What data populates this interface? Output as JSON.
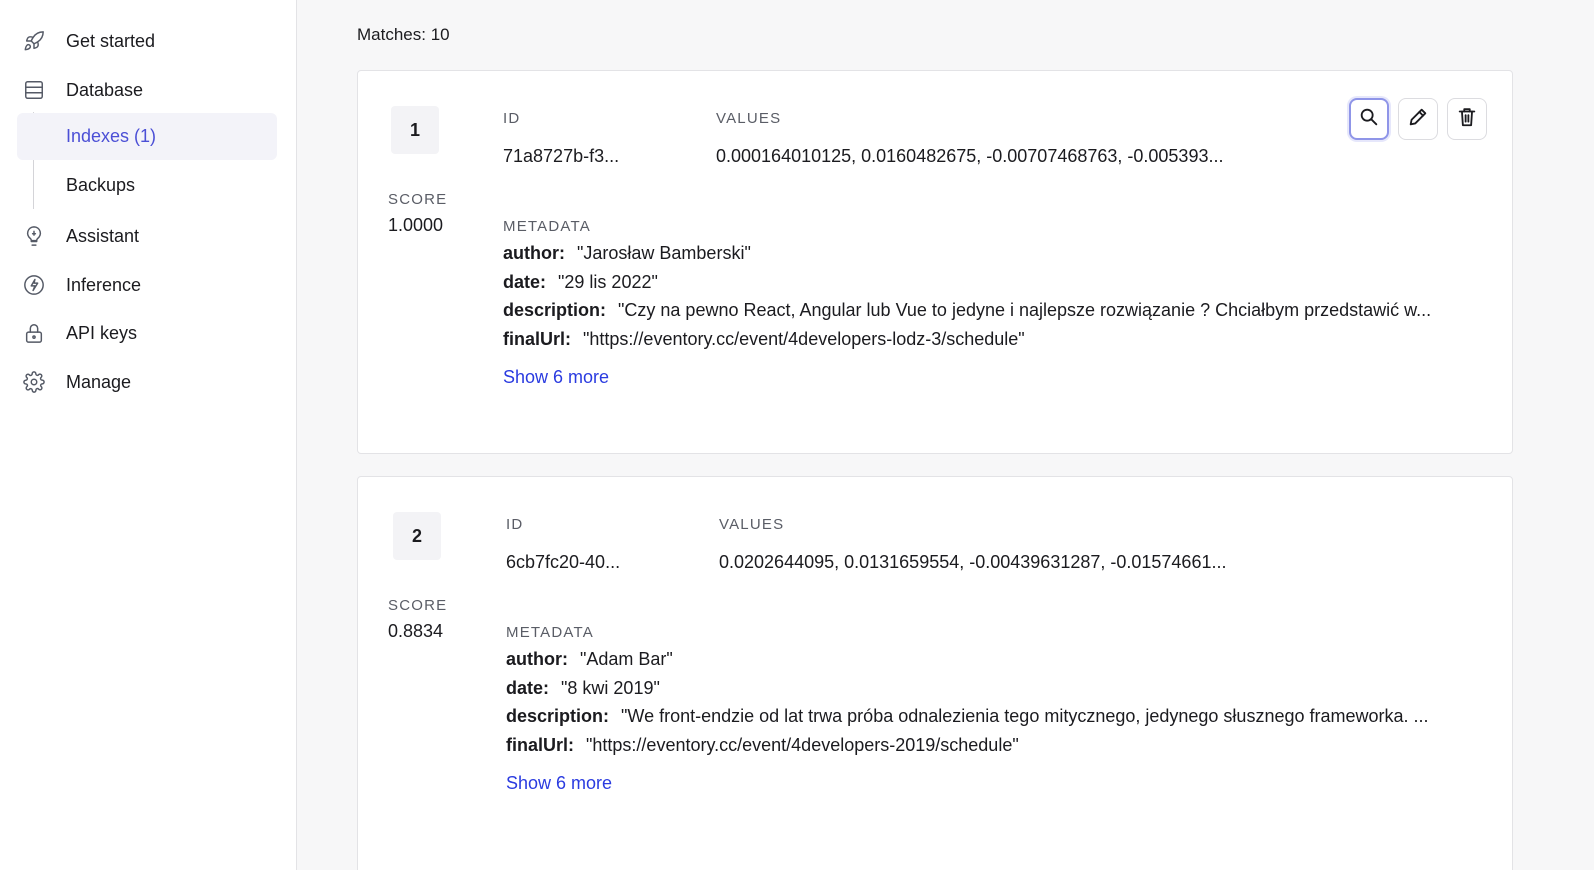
{
  "sidebar": {
    "items": [
      {
        "label": "Get started",
        "icon": "rocket-icon"
      },
      {
        "label": "Database",
        "icon": "database-icon"
      },
      {
        "label": "Assistant",
        "icon": "lightbulb-icon"
      },
      {
        "label": "Inference",
        "icon": "bolt-icon"
      },
      {
        "label": "API keys",
        "icon": "lock-icon"
      },
      {
        "label": "Manage",
        "icon": "gear-icon"
      }
    ],
    "sub_items": [
      {
        "label": "Indexes (1)",
        "active": true
      },
      {
        "label": "Backups",
        "active": false
      }
    ],
    "accent_color": "#4b4fd6"
  },
  "main": {
    "matches_label": "Matches: 10",
    "labels": {
      "id": "ID",
      "values": "VALUES",
      "score": "SCORE",
      "metadata": "METADATA"
    },
    "results": [
      {
        "rank": "1",
        "id": "71a8727b-f3...",
        "values": "0.000164010125, 0.0160482675, -0.00707468763, -0.005393...",
        "score": "1.0000",
        "metadata": [
          {
            "key": "author:",
            "value": "\"Jarosław Bamberski\""
          },
          {
            "key": "date:",
            "value": "\"29 lis 2022\""
          },
          {
            "key": "description:",
            "value": "\"Czy na pewno React, Angular lub Vue to jedyne i najlepsze rozwiązanie ? Chciałbym przedstawić w..."
          },
          {
            "key": "finalUrl:",
            "value": "\"https://eventory.cc/event/4developers-lodz-3/schedule\""
          }
        ],
        "show_more": "Show 6 more"
      },
      {
        "rank": "2",
        "id": "6cb7fc20-40...",
        "values": "0.0202644095, 0.0131659554, -0.00439631287, -0.01574661...",
        "score": "0.8834",
        "metadata": [
          {
            "key": "author:",
            "value": "\"Adam Bar\""
          },
          {
            "key": "date:",
            "value": "\"8 kwi 2019\""
          },
          {
            "key": "description:",
            "value": "\"We front-endzie od lat trwa próba odnalezienia tego mitycznego, jedynego słusznego frameworka. ..."
          },
          {
            "key": "finalUrl:",
            "value": "\"https://eventory.cc/event/4developers-2019/schedule\""
          }
        ],
        "show_more": "Show 6 more"
      }
    ],
    "actions": [
      {
        "icon": "search-icon"
      },
      {
        "icon": "pencil-icon"
      },
      {
        "icon": "trash-icon"
      }
    ],
    "link_color": "#2a3be0"
  }
}
